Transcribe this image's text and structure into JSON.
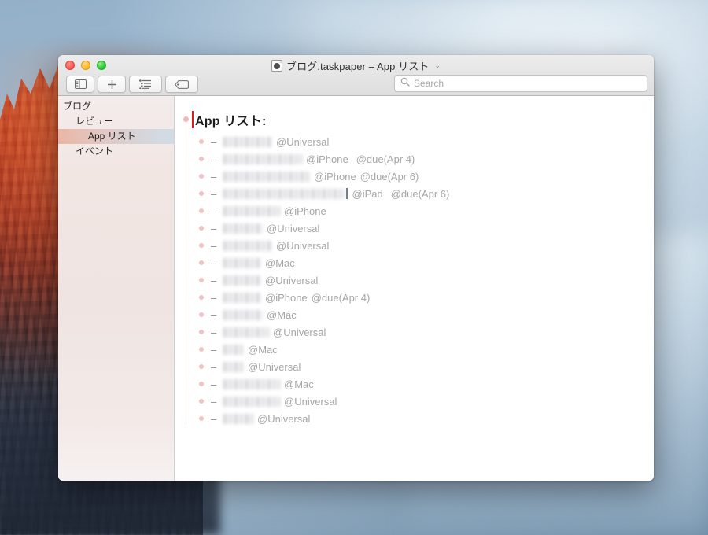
{
  "window": {
    "title": "ブログ.taskpaper – App リスト",
    "title_chevron": "⌄",
    "doc_icon": "taskpaper-document-icon",
    "traffic_lights": {
      "close": "close-button",
      "minimize": "minimize-button",
      "maximize": "maximize-button"
    }
  },
  "toolbar": {
    "buttons": [
      {
        "name": "toggle-sidebar-button",
        "icon": "sidebar-icon"
      },
      {
        "name": "new-item-button",
        "icon": "plus-icon"
      },
      {
        "name": "outline-button",
        "icon": "list-icon"
      },
      {
        "name": "tag-button",
        "icon": "tag-icon"
      }
    ],
    "search": {
      "placeholder": "Search",
      "value": "",
      "icon": "search-icon"
    }
  },
  "sidebar": {
    "items": [
      {
        "label": "ブログ",
        "level": 1,
        "selected": false
      },
      {
        "label": "レビュー",
        "level": 2,
        "selected": false
      },
      {
        "label": "App リスト",
        "level": 3,
        "selected": true
      },
      {
        "label": "イベント",
        "level": 2,
        "selected": false
      }
    ]
  },
  "editor": {
    "project": {
      "title": "App リスト:",
      "caret": true
    },
    "tasks": [
      {
        "name_width": 62,
        "tags": [
          "@Universal"
        ]
      },
      {
        "name_width": 100,
        "tags": [
          "@iPhone",
          "@due(Apr 4)"
        ],
        "tag_gap": true
      },
      {
        "name_width": 110,
        "tags": [
          "@iPhone",
          "@due(Apr 6)"
        ]
      },
      {
        "name_width": 155,
        "tags": [
          "@iPad",
          "@due(Apr 6)"
        ],
        "tag_gap": true,
        "caret_after_name": true
      },
      {
        "name_width": 72,
        "tags": [
          "@iPhone"
        ]
      },
      {
        "name_width": 50,
        "tags": [
          "@Universal"
        ]
      },
      {
        "name_width": 62,
        "tags": [
          "@Universal"
        ]
      },
      {
        "name_width": 48,
        "tags": [
          "@Mac"
        ]
      },
      {
        "name_width": 48,
        "tags": [
          "@Universal"
        ]
      },
      {
        "name_width": 48,
        "tags": [
          "@iPhone",
          "@due(Apr 4)"
        ]
      },
      {
        "name_width": 50,
        "tags": [
          "@Mac"
        ]
      },
      {
        "name_width": 58,
        "tags": [
          "@Universal"
        ]
      },
      {
        "name_width": 26,
        "tags": [
          "@Mac"
        ]
      },
      {
        "name_width": 26,
        "tags": [
          "@Universal"
        ]
      },
      {
        "name_width": 72,
        "tags": [
          "@Mac"
        ]
      },
      {
        "name_width": 72,
        "tags": [
          "@Universal"
        ]
      },
      {
        "name_width": 38,
        "tags": [
          "@Universal"
        ]
      }
    ]
  },
  "colors": {
    "selection_start": "#e9b6a6",
    "selection_end": "#d2dbe3",
    "caret": "#d81f1f",
    "bullet": "#f4c2c2",
    "tag_text": "#a6a6a6",
    "sidebar_bg": "#f2e6e3"
  }
}
